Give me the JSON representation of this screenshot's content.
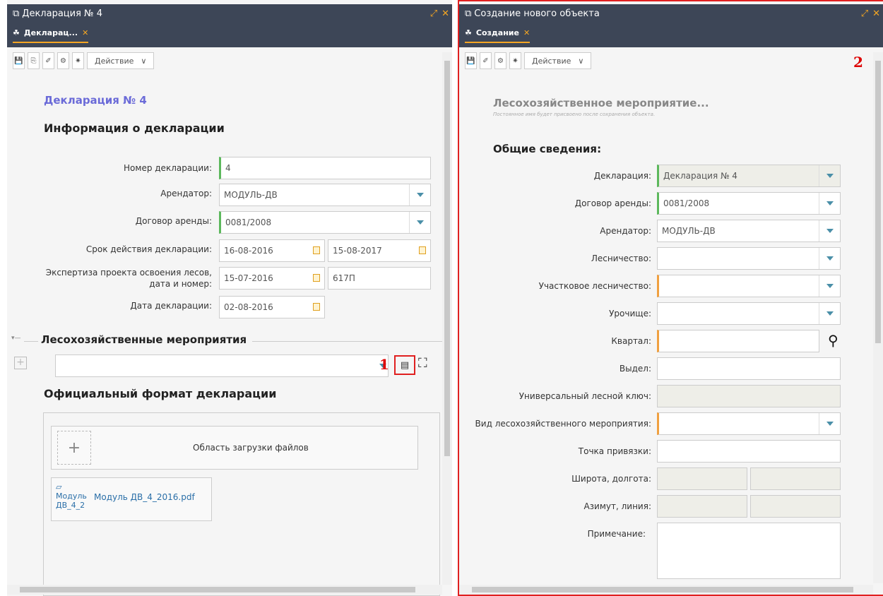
{
  "left": {
    "window_title": "Декларация № 4",
    "tab_label": "Декларац...",
    "action_label": "Действие",
    "heading": "Декларация № 4",
    "info_heading": "Информация о декларации",
    "fields": {
      "number_label": "Номер декларации:",
      "number_value": "4",
      "tenant_label": "Арендатор:",
      "tenant_value": "МОДУЛЬ-ДВ",
      "contract_label": "Договор аренды:",
      "contract_value": "0081/2008",
      "period_label": "Срок действия декларации:",
      "period_from": "16-08-2016",
      "period_to": "15-08-2017",
      "expertise_label1": "Экспертиза проекта освоения лесов,",
      "expertise_label2": "дата и номер:",
      "expertise_date": "15-07-2016",
      "expertise_number": "617П",
      "date_label": "Дата декларации:",
      "date_value": "02-08-2016"
    },
    "section_heading": "Лесохозяйственные мероприятия",
    "marker1": "1",
    "official_heading": "Официальный формат декларации",
    "upload_area": "Область загрузки файлов",
    "file_thumb_alt1": "Модуль",
    "file_thumb_alt2": "ДВ_4_2",
    "file_name": "Модуль ДВ_4_2016.pdf"
  },
  "right": {
    "window_title": "Создание нового объекта",
    "tab_label": "Создание",
    "action_label": "Действие",
    "marker2": "2",
    "heading": "Лесохозяйственное мероприятие...",
    "subheading": "Постоянное имя будет присвоено после сохранения объекта.",
    "general_heading": "Общие сведения:",
    "fields": {
      "declaration_label": "Декларация:",
      "declaration_value": "Декларация № 4",
      "contract_label": "Договор аренды:",
      "contract_value": "0081/2008",
      "tenant_label": "Арендатор:",
      "tenant_value": "МОДУЛЬ-ДВ",
      "forestry_label": "Лесничество:",
      "district_label": "Участковое лесничество:",
      "tract_label": "Урочище:",
      "quarter_label": "Квартал:",
      "allotment_label": "Выдел:",
      "key_label": "Универсальный лесной ключ:",
      "activity_label": "Вид лесохозяйственного мероприятия:",
      "anchor_label": "Точка привязки:",
      "latlon_label": "Широта, долгота:",
      "azimuth_label": "Азимут, линия:",
      "note_label": "Примечание:"
    }
  }
}
